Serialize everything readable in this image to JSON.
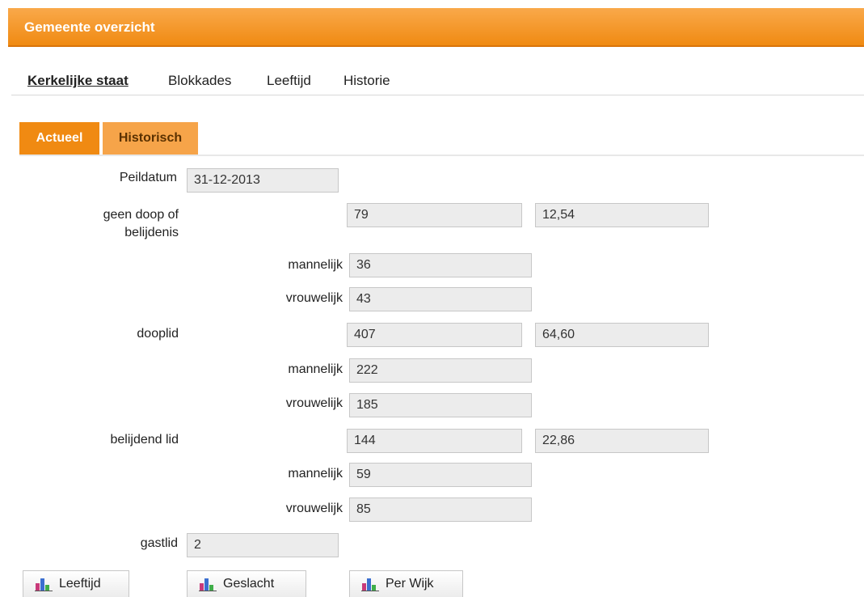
{
  "header": {
    "title": "Gemeente overzicht"
  },
  "nav": [
    {
      "label": "Kerkelijke staat",
      "active": true
    },
    {
      "label": "Blokkades"
    },
    {
      "label": "Leeftijd"
    },
    {
      "label": "Historie"
    }
  ],
  "tabs": [
    {
      "label": "Actueel",
      "active": true
    },
    {
      "label": "Historisch"
    }
  ],
  "form": {
    "peildatum": {
      "label": "Peildatum",
      "value": "31-12-2013"
    },
    "groups": [
      {
        "label": "geen doop of belijdenis",
        "total": "79",
        "percentage": "12,54",
        "mannelijk_label": "mannelijk",
        "mannelijk": "36",
        "vrouwelijk_label": "vrouwelijk",
        "vrouwelijk": "43"
      },
      {
        "label": "dooplid",
        "total": "407",
        "percentage": "64,60",
        "mannelijk_label": "mannelijk",
        "mannelijk": "222",
        "vrouwelijk_label": "vrouwelijk",
        "vrouwelijk": "185"
      },
      {
        "label": "belijdend lid",
        "total": "144",
        "percentage": "22,86",
        "mannelijk_label": "mannelijk",
        "mannelijk": "59",
        "vrouwelijk_label": "vrouwelijk",
        "vrouwelijk": "85"
      }
    ],
    "gastlid": {
      "label": "gastlid",
      "value": "2"
    }
  },
  "buttons": [
    {
      "label": "Leeftijd",
      "icon": "bar-chart-icon"
    },
    {
      "label": "Geslacht",
      "icon": "bar-chart-icon"
    },
    {
      "label": "Per Wijk",
      "icon": "bar-chart-icon"
    }
  ],
  "colors": {
    "accent": "#f08a12",
    "tab_inactive": "#f6a449",
    "field_bg": "#ececec"
  }
}
